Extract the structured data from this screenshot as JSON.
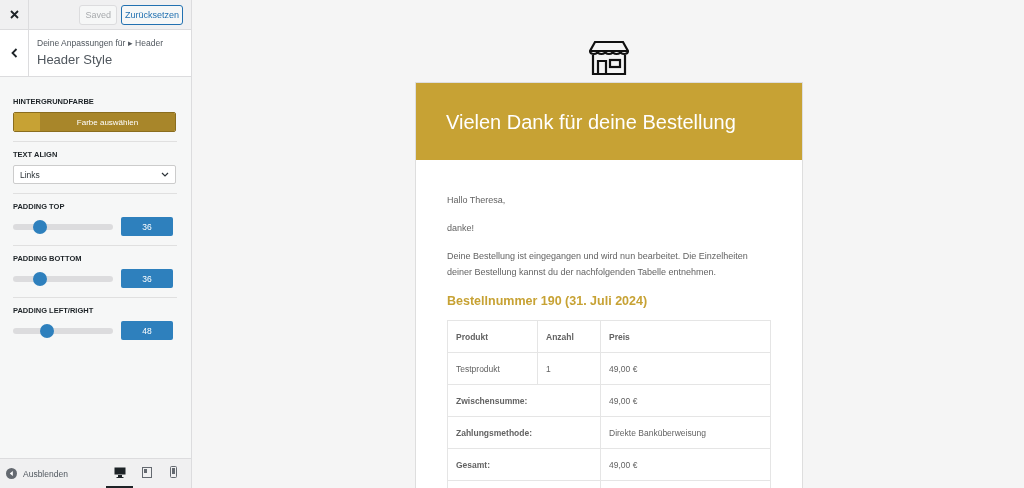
{
  "topbar": {
    "saved_label": "Saved",
    "reset_button": "Zurücksetzen"
  },
  "section_header": {
    "breadcrumb": "Deine Anpassungen für ▸ Header",
    "title": "Header Style"
  },
  "controls": [
    {
      "kind": "color",
      "label": "HINTERGRUNDFARBE",
      "button": "Farbe auswählen",
      "color": "#c7a234"
    },
    {
      "kind": "select",
      "label": "TEXT ALIGN",
      "value": "Links"
    },
    {
      "kind": "slider",
      "label": "PADDING TOP",
      "level": 0.27,
      "value": "36"
    },
    {
      "kind": "slider",
      "label": "PADDING BOTTOM",
      "level": 0.27,
      "value": "36"
    },
    {
      "kind": "slider",
      "label": "PADDING LEFT/RIGHT",
      "level": 0.34,
      "value": "48"
    }
  ],
  "footer": {
    "hide_label": "Ausblenden",
    "devices": [
      {
        "kind": "desktop",
        "selected": true
      },
      {
        "kind": "tablet",
        "selected": false
      },
      {
        "kind": "mobile",
        "selected": false
      }
    ]
  },
  "email": {
    "heading": "Vielen Dank für deine Bestellung",
    "greeting": "Hallo Theresa,",
    "thanks": "danke!",
    "intro": "Deine Bestellung ist eingegangen und wird nun bearbeitet. Die Einzelheiten deiner Bestellung kannst du der nachfolgenden Tabelle entnehmen.",
    "order_title": "Bestellnummer 190 (31. Juli 2024)",
    "table": {
      "columns": [
        "Produkt",
        "Anzahl",
        "Preis"
      ],
      "rows": [
        [
          "Testprodukt",
          "1",
          "49,00 €"
        ]
      ],
      "totals": [
        {
          "label": "Zwischensumme:",
          "value": "49,00 €"
        },
        {
          "label": "Zahlungsmethode:",
          "value": "Direkte Banküberweisung"
        },
        {
          "label": "Gesamt:",
          "value": "49,00 €"
        }
      ]
    }
  }
}
